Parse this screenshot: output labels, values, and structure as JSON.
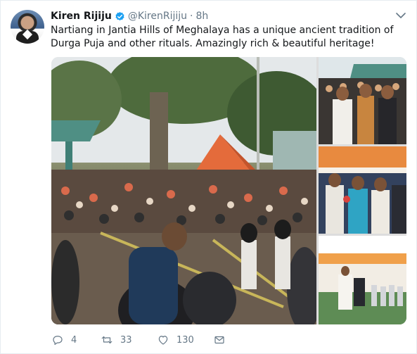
{
  "user": {
    "name": "Kiren Rijiju",
    "handle": "@KirenRijiju",
    "time": "8h",
    "separator": "·"
  },
  "tweet": {
    "text": "Nartiang in Jantia Hills of Meghalaya has a unique ancient tradition of Durga Puja and other rituals. Amazingly rich & beautiful heritage!"
  },
  "actions": {
    "reply_count": "4",
    "retweet_count": "33",
    "like_count": "130"
  },
  "icons": {
    "verified": "verified-badge-icon",
    "caret": "chevron-down-icon",
    "reply": "reply-icon",
    "retweet": "retweet-icon",
    "like": "heart-icon",
    "dm": "envelope-icon"
  },
  "colors": {
    "verified": "#1da1f2",
    "muted": "#657786",
    "text": "#14171a"
  }
}
